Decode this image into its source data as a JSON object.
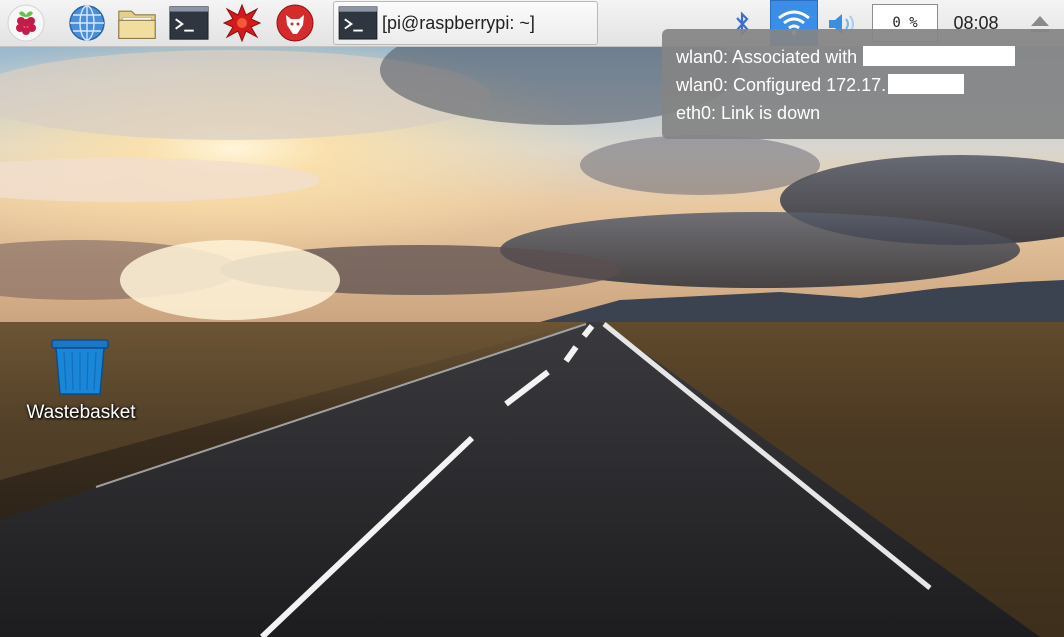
{
  "taskbar": {
    "launchers": [
      {
        "name": "raspberry-menu-icon"
      },
      {
        "name": "web-browser-icon"
      },
      {
        "name": "file-manager-icon"
      },
      {
        "name": "terminal-icon"
      },
      {
        "name": "mathematica-icon"
      },
      {
        "name": "wolfram-icon"
      }
    ],
    "window_button": {
      "label": "[pi@raspberrypi: ~]",
      "icon": "terminal-icon"
    },
    "tray": {
      "bluetooth_icon": "bluetooth-icon",
      "wifi_icon": "wifi-icon",
      "volume_icon": "volume-icon",
      "cpu_label": "0 %",
      "clock": "08:08",
      "eject_icon": "eject-icon"
    }
  },
  "network_tooltip": {
    "line1": "wlan0: Associated with",
    "line2": "wlan0: Configured 172.17.",
    "line3": "eth0: Link is down"
  },
  "desktop": {
    "wastebasket_label": "Wastebasket"
  },
  "colors": {
    "taskbar_bg": "#e9e9e9",
    "wifi_highlight": "#3b8ee8",
    "tooltip_bg": "#848484",
    "accent_red": "#c51a4a"
  }
}
